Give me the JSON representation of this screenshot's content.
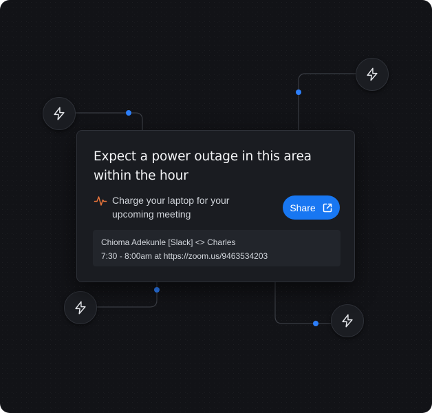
{
  "notification": {
    "title": "Expect a power outage in this area within the hour",
    "message": "Charge your laptop for your upcoming meeting",
    "message_icon": "pulse-icon",
    "share_label": "Share",
    "share_icon": "external-link-icon",
    "meeting": {
      "participants": "Chioma Adekunle [Slack] <> Charles",
      "schedule": "7:30 - 8:00am at https://zoom.us/9463534203"
    }
  },
  "nodes": [
    {
      "icon": "lightning-icon"
    },
    {
      "icon": "lightning-icon"
    },
    {
      "icon": "lightning-icon"
    },
    {
      "icon": "lightning-icon"
    }
  ],
  "colors": {
    "background": "#121317",
    "card": "#1a1c21",
    "accent_blue": "#1877f2",
    "connector_dot": "#2d7ff9",
    "pulse_orange": "#e8743b"
  }
}
